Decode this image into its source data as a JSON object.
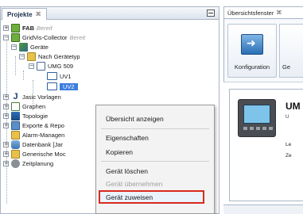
{
  "projects_panel": {
    "tab_label": "Projekte",
    "tab_close": "⌘",
    "tree": [
      {
        "label": "FAB",
        "status": "Bereit",
        "icon": "project-icon"
      },
      {
        "label": "GridVis-Collector",
        "status": "Bereit",
        "icon": "project-icon"
      },
      {
        "label": "Geräte",
        "icon": "devices-icon"
      },
      {
        "label": "Nach Gerätetyp",
        "icon": "folder-icon"
      },
      {
        "label": "UMG 509",
        "icon": "device-type-icon"
      },
      {
        "label": "UV1",
        "icon": "device-icon"
      },
      {
        "label": "UV2",
        "icon": "device-icon",
        "selected": true
      },
      {
        "label": "Jasic Vorlagen",
        "icon": "jasic-icon"
      },
      {
        "label": "Graphen",
        "icon": "graph-icon"
      },
      {
        "label": "Topologie",
        "icon": "topology-icon"
      },
      {
        "label": "Exporte & Repo",
        "icon": "export-icon"
      },
      {
        "label": "Alarm-Managen",
        "icon": "alarm-icon"
      },
      {
        "label": "Datenbank [Jar",
        "icon": "database-icon"
      },
      {
        "label": "Generische Moc",
        "icon": "generic-icon"
      },
      {
        "label": "Zeitplanung",
        "icon": "schedule-icon"
      }
    ]
  },
  "context_menu": {
    "items": [
      {
        "label": "Übersicht anzeigen",
        "enabled": true
      },
      {
        "label": "Eigenschaften",
        "enabled": true
      },
      {
        "label": "Kopieren",
        "enabled": true
      },
      {
        "label": "Gerät löschen",
        "enabled": true
      },
      {
        "label": "Gerät übernehmen",
        "enabled": false
      },
      {
        "label": "Gerät zuweisen",
        "enabled": true,
        "highlighted": true
      }
    ]
  },
  "overview_window": {
    "tab_label": "Übersichtsfenster",
    "tab_close": "⌘",
    "toolbar": {
      "config_label": "Konfiguration",
      "second_label": "Ge"
    },
    "device": {
      "title": "UM",
      "subtitle": "U",
      "line1": "Le",
      "line2": "Ze"
    }
  },
  "colors": {
    "highlight_border": "#d9291c",
    "selection_bg": "#3c7ddd",
    "panel_border": "#a9b6c6"
  }
}
